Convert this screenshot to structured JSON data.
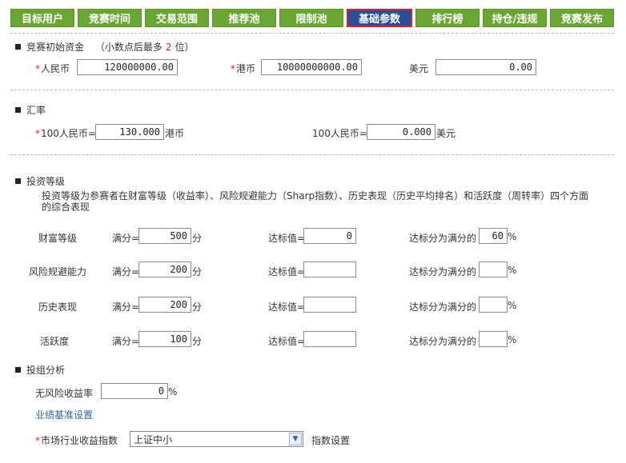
{
  "tabs": [
    {
      "label": "目标用户"
    },
    {
      "label": "竞赛时间"
    },
    {
      "label": "交易范围"
    },
    {
      "label": "推荐池"
    },
    {
      "label": "限制池"
    },
    {
      "label": "基础参数",
      "active": true
    },
    {
      "label": "排行榜"
    },
    {
      "label": "持仓/违规"
    },
    {
      "label": "竞赛发布"
    }
  ],
  "capital": {
    "title": "竞赛初始资金",
    "note_prefix": "（小数点后最多",
    "note_num": "2",
    "note_suffix": "位）",
    "rmb_label": "人民币",
    "rmb_value": "120000000.00",
    "hkd_label": "港币",
    "hkd_value": "10000000000.00",
    "usd_label": "美元",
    "usd_value": "0.00"
  },
  "rate": {
    "title": "汇率",
    "hkd_prefix": "100人民币=",
    "hkd_value": "130.000",
    "hkd_unit": "港币",
    "usd_prefix": "100人民币=",
    "usd_value": "0.000",
    "usd_unit": "美元"
  },
  "grade": {
    "title": "投资等级",
    "description": "投资等级为参赛者在财富等级（收益率）、风险规避能力（Sharp指数）、历史表现（历史平均排名）和活跃度（周转率）四个方面的综合表现",
    "full_label": "满分=",
    "score_unit": "分",
    "target_label": "达标值=",
    "pct_label": "达标分为满分的",
    "pct_unit": "%",
    "rows": [
      {
        "name": "财富等级",
        "full": "500",
        "target": "0",
        "pct": "60"
      },
      {
        "name": "风险规避能力",
        "full": "200",
        "target": "",
        "pct": ""
      },
      {
        "name": "历史表现",
        "full": "200",
        "target": "",
        "pct": ""
      },
      {
        "name": "活跃度",
        "full": "100",
        "target": "",
        "pct": ""
      }
    ]
  },
  "portfolio": {
    "title": "投组分析",
    "riskfree_label": "无风险收益率",
    "riskfree_value": "0",
    "riskfree_unit": "%",
    "benchmark_link": "业绩基准设置",
    "market_label": "市场行业收益指数",
    "market_value": "上证中小",
    "index_link": "指数设置"
  },
  "colors": {
    "tab_green": "#6aa632",
    "tab_active": "#2a4f9a",
    "required": "#e02020",
    "link": "#2a62a9"
  }
}
